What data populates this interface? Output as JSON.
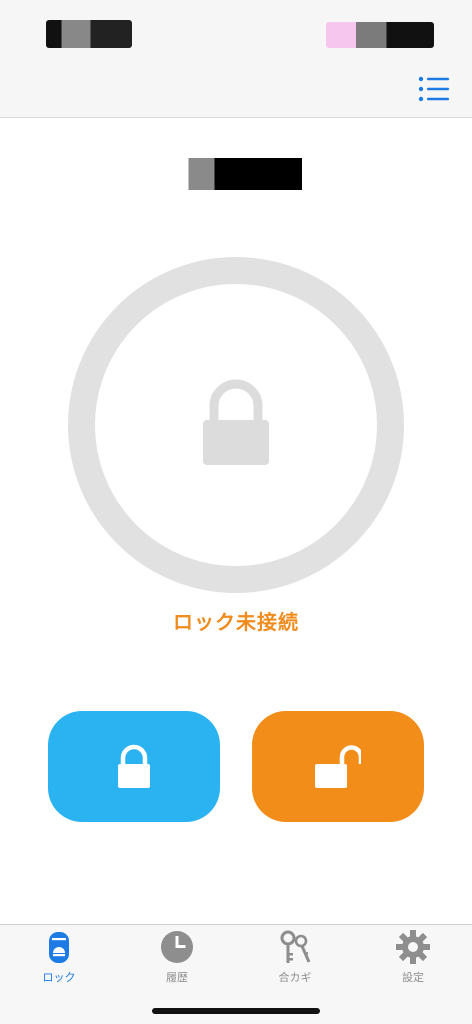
{
  "header": {
    "menu_icon": "list-icon"
  },
  "device": {
    "status_text": "ロック未接続"
  },
  "actions": {
    "lock_icon": "lock-closed-icon",
    "unlock_icon": "lock-open-icon"
  },
  "tabs": [
    {
      "label": "ロック",
      "icon": "door-lock-icon",
      "active": true
    },
    {
      "label": "履歴",
      "icon": "clock-icon",
      "active": false
    },
    {
      "label": "合カギ",
      "icon": "keys-icon",
      "active": false
    },
    {
      "label": "設定",
      "icon": "gear-icon",
      "active": false
    }
  ],
  "colors": {
    "accent_blue": "#2ab2f1",
    "accent_orange": "#f28d1a",
    "status_orange": "#f08c1d",
    "ring_gray": "#e1e1e1",
    "tab_active": "#1e7be6",
    "tab_inactive": "#8e8e8e"
  }
}
